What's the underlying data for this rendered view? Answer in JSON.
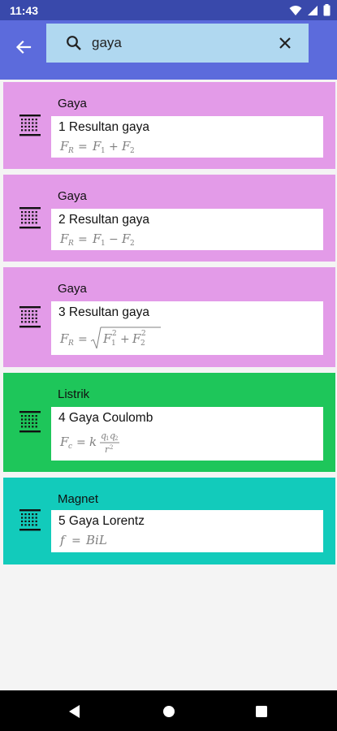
{
  "status_bar": {
    "time": "11:43",
    "icons": [
      "wifi-icon",
      "signal-icon",
      "battery-icon"
    ]
  },
  "app_bar": {
    "back_icon": "arrow-back-icon",
    "search": {
      "value": "gaya",
      "placeholder": ""
    },
    "clear_icon": "close-icon",
    "color": "#5c6bdc",
    "search_bg": "#b0d8f0"
  },
  "results": [
    {
      "category": "Gaya",
      "title": "1 Resultan gaya",
      "formula": "F_R = F_1 + F_2",
      "color": "#e39be8"
    },
    {
      "category": "Gaya",
      "title": "2 Resultan gaya",
      "formula": "F_R = F_1 − F_2",
      "color": "#e39be8"
    },
    {
      "category": "Gaya",
      "title": "3 Resultan gaya",
      "formula": "F_R = √(F_1² + F_2²)",
      "color": "#e39be8"
    },
    {
      "category": "Listrik",
      "title": "4 Gaya Coulomb",
      "formula": "F_c = k q_1 q_2 / r²",
      "color": "#1ec65a"
    },
    {
      "category": "Magnet",
      "title": "5 Gaya Lorentz",
      "formula": "f = BiL",
      "color": "#12cbbb"
    }
  ],
  "nav_bar": {
    "back_icon": "nav-back-icon",
    "home_icon": "nav-home-icon",
    "recents_icon": "nav-recents-icon"
  }
}
